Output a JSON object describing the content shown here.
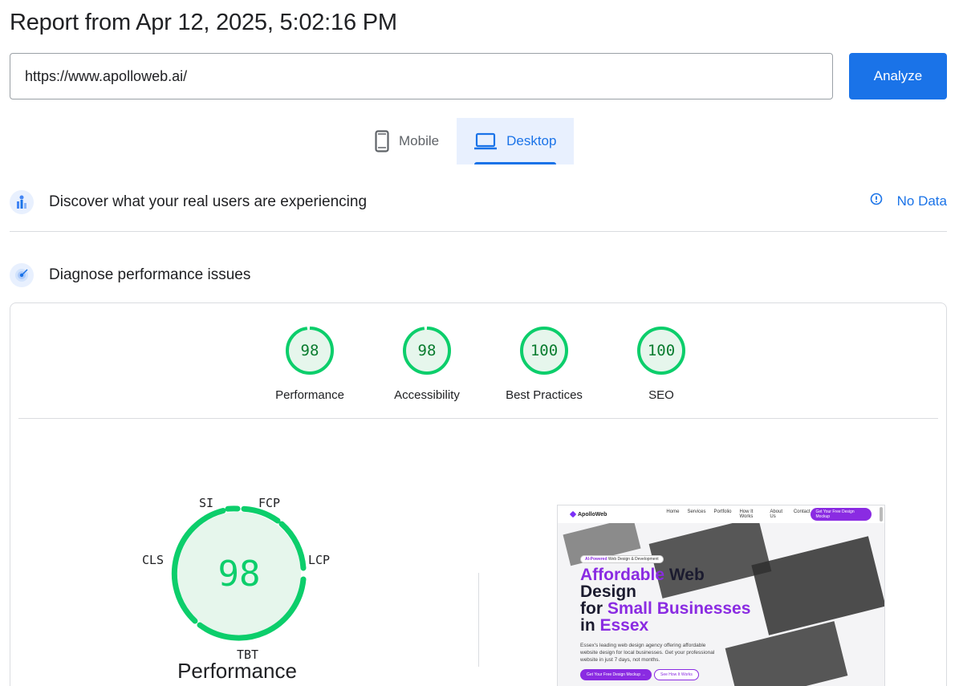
{
  "report": {
    "title": "Report from Apr 12, 2025, 5:02:16 PM"
  },
  "search": {
    "value": "https://www.apolloweb.ai/",
    "button_label": "Analyze"
  },
  "tabs": [
    {
      "label": "Mobile",
      "icon": "smartphone-icon",
      "active": false
    },
    {
      "label": "Desktop",
      "icon": "laptop-icon",
      "active": true
    }
  ],
  "field_data": {
    "title": "Discover what your real users are experiencing",
    "status": "No Data",
    "status_icon": "info-icon"
  },
  "lab_data": {
    "title": "Diagnose performance issues"
  },
  "scores": [
    {
      "label": "Performance",
      "value": "98",
      "fraction": 0.98
    },
    {
      "label": "Accessibility",
      "value": "98",
      "fraction": 0.98
    },
    {
      "label": "Best Practices",
      "value": "100",
      "fraction": 1.0
    },
    {
      "label": "SEO",
      "value": "100",
      "fraction": 1.0
    }
  ],
  "performance_gauge": {
    "value": "98",
    "title": "Performance",
    "metrics": [
      "SI",
      "FCP",
      "LCP",
      "TBT",
      "CLS"
    ]
  },
  "colors": {
    "accent": "#1a73e8",
    "pass": "#0cce6b",
    "pass_bg": "#e6f6ec",
    "pass_text": "#0a7c2f"
  },
  "screenshot": {
    "logo": "ApolloWeb",
    "nav_links": [
      "Home",
      "Services",
      "Portfolio",
      "How It Works",
      "About Us",
      "Contact"
    ],
    "nav_cta": "Get Your Free Design Mockup",
    "badge_highlight": "AI-Powered",
    "badge_rest": " Web Design & Development",
    "headline_1a": "Affordable",
    "headline_1b": " Web",
    "headline_2": "Design",
    "headline_3a": "for ",
    "headline_3b": "Small Businesses",
    "headline_4a": "in ",
    "headline_4b": "Essex",
    "paragraph": "Essex's leading web design agency offering affordable website design for local businesses. Get your professional website in just 7 days, not months.",
    "button_primary": "Get Your Free Design Mockup →",
    "button_secondary": "See How It Works"
  }
}
